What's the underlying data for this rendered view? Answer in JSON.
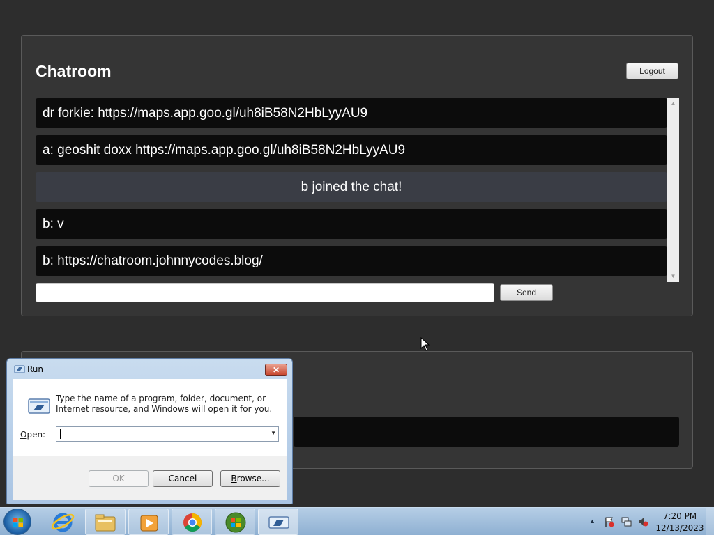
{
  "chat": {
    "title": "Chatroom",
    "logout_label": "Logout",
    "send_label": "Send",
    "input_value": "",
    "messages": [
      {
        "text": "dr forkie: https://maps.app.goo.gl/uh8iB58N2HbLyyAU9",
        "type": "user"
      },
      {
        "text": "a: geoshit doxx https://maps.app.goo.gl/uh8iB58N2HbLyyAU9",
        "type": "user"
      },
      {
        "text": "b joined the chat!",
        "type": "system"
      },
      {
        "text": "b: v",
        "type": "user"
      },
      {
        "text": "b: https://chatroom.johnnycodes.blog/",
        "type": "user"
      }
    ]
  },
  "run_dialog": {
    "title": "Run",
    "description": "Type the name of a program, folder, document, or Internet resource, and Windows will open it for you.",
    "open_label_accel": "O",
    "open_label_rest": "pen:",
    "open_value": "",
    "ok_label": "OK",
    "cancel_label": "Cancel",
    "browse_accel": "B",
    "browse_rest": "rowse..."
  },
  "taskbar": {
    "items": [
      "start-button",
      "internet-explorer-icon",
      "windows-explorer-icon",
      "media-player-icon",
      "chrome-icon",
      "windows-logo-icon",
      "run-icon"
    ],
    "clock_time": "7:20 PM",
    "clock_date": "12/13/2023"
  },
  "colors": {
    "page_bg": "#2d2d2d",
    "panel_bg": "#353535",
    "message_bg": "#0c0c0c",
    "system_message_bg": "#3a3d45"
  }
}
